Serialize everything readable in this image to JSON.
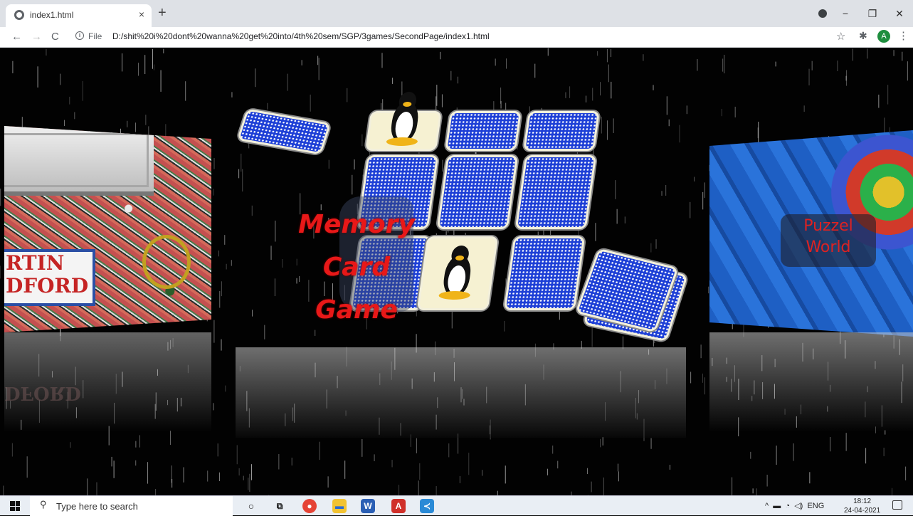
{
  "browser": {
    "tab_title": "index1.html",
    "tab_close": "×",
    "new_tab": "+",
    "window_controls": {
      "minimize": "−",
      "maximize": "❐",
      "close": "✕"
    },
    "nav": {
      "back": "←",
      "forward": "→",
      "reload": "C"
    },
    "address": {
      "scheme_label": "File",
      "url": "D:/shit%20i%20dont%20wanna%20get%20into/4th%20sem/SGP/3games/SecondPage/index1.html"
    },
    "avatar_letter": "A",
    "icons": [
      "info-icon",
      "star-icon",
      "puzzle-extension-icon",
      "menu-icon"
    ]
  },
  "page": {
    "left_panel": {
      "sign_lines": [
        "RTIN",
        "DFORD"
      ],
      "reflection_text": "DFORD"
    },
    "center_panel": {
      "title_lines": [
        "Memory",
        "Card",
        "Game"
      ]
    },
    "right_panel": {
      "title_lines": [
        "Puzzel",
        "World"
      ]
    },
    "colors": {
      "title_red": "#e81818",
      "card_blue": "#1d3fd6"
    }
  },
  "taskbar": {
    "search_placeholder": "Type here to search",
    "apps": [
      "cortana-icon",
      "task-view-icon",
      "chrome-icon",
      "file-explorer-icon",
      "word-icon",
      "acrobat-icon",
      "vscode-icon"
    ],
    "tray_text": "ENG",
    "time": "18:12",
    "date": "24-04-2021"
  }
}
